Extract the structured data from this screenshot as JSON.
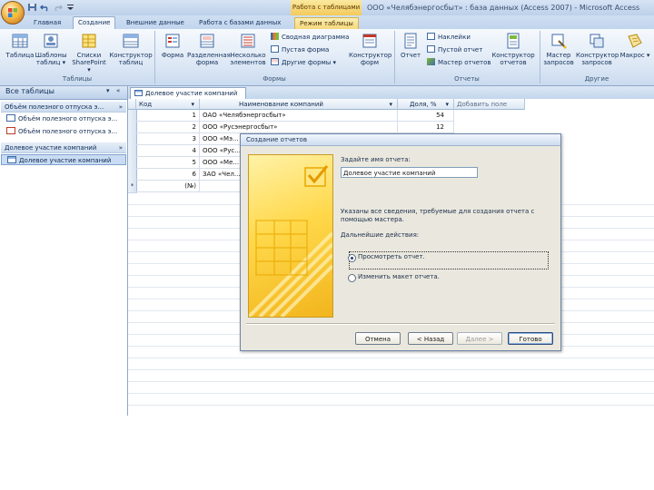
{
  "window": {
    "title": "ООО «Челябэнергосбыт» : база данных (Access 2007) - Microsoft Access",
    "context_tab_title": "Работа с таблицами"
  },
  "tabs": [
    "Главная",
    "Создание",
    "Внешние данные",
    "Работа с базами данных",
    "Режим таблицы"
  ],
  "active_tab": "Создание",
  "ribbon": {
    "tables": {
      "buttons": [
        "Таблица",
        "Шаблоны таблиц ▾",
        "Списки SharePoint ▾",
        "Конструктор таблиц"
      ],
      "label": "Таблицы"
    },
    "forms": {
      "buttons": [
        "Форма",
        "Разделенная форма",
        "Несколько элементов",
        "Конструктор форм"
      ],
      "small": [
        "Сводная диаграмма",
        "Пустая форма",
        "Другие формы ▾"
      ],
      "label": "Формы"
    },
    "reports": {
      "buttons": [
        "Отчет",
        "Конструктор отчетов"
      ],
      "small": [
        "Наклейки",
        "Пустой отчет",
        "Мастер отчетов"
      ],
      "label": "Отчеты"
    },
    "other": {
      "buttons": [
        "Мастер запросов",
        "Конструктор запросов",
        "Макрос ▾"
      ],
      "label": "Другие"
    }
  },
  "nav": {
    "header": "Все таблицы",
    "groups": [
      {
        "title": "Объём полезного отпуска э...",
        "items": [
          "Объём полезного отпуска э...",
          "Объём полезного отпуска э..."
        ]
      },
      {
        "title": "Долевое участие компаний",
        "items": [
          "Долевое участие компаний"
        ]
      }
    ]
  },
  "document": {
    "tab_label": "Долевое участие компаний",
    "columns": [
      "Код",
      "Наименование компаний",
      "Доля, %",
      "Добавить поле"
    ],
    "rows": [
      {
        "code": "1",
        "name": "ОАО «Челябэнергосбыт»",
        "share": "54"
      },
      {
        "code": "2",
        "name": "ООО «Русэнергосбыт»",
        "share": "12"
      },
      {
        "code": "3",
        "name": "ООО «Мэ...",
        "share": ""
      },
      {
        "code": "4",
        "name": "ООО «Рус...",
        "share": ""
      },
      {
        "code": "5",
        "name": "ООО «Ме...",
        "share": ""
      },
      {
        "code": "6",
        "name": "ЗАО «Чел...",
        "share": ""
      }
    ],
    "new_row": "(№)"
  },
  "dialog": {
    "title": "Создание отчетов",
    "name_prompt": "Задайте имя отчета:",
    "report_name": "Долевое участие компаний",
    "info": "Указаны все сведения, требуемые для создания отчета с помощью мастера.",
    "next_prompt": "Дальнейшие действия:",
    "options": [
      "Просмотреть отчет.",
      "Изменить макет отчета."
    ],
    "buttons": {
      "cancel": "Отмена",
      "back": "< Назад",
      "next": "Далее >",
      "finish": "Готово"
    }
  }
}
